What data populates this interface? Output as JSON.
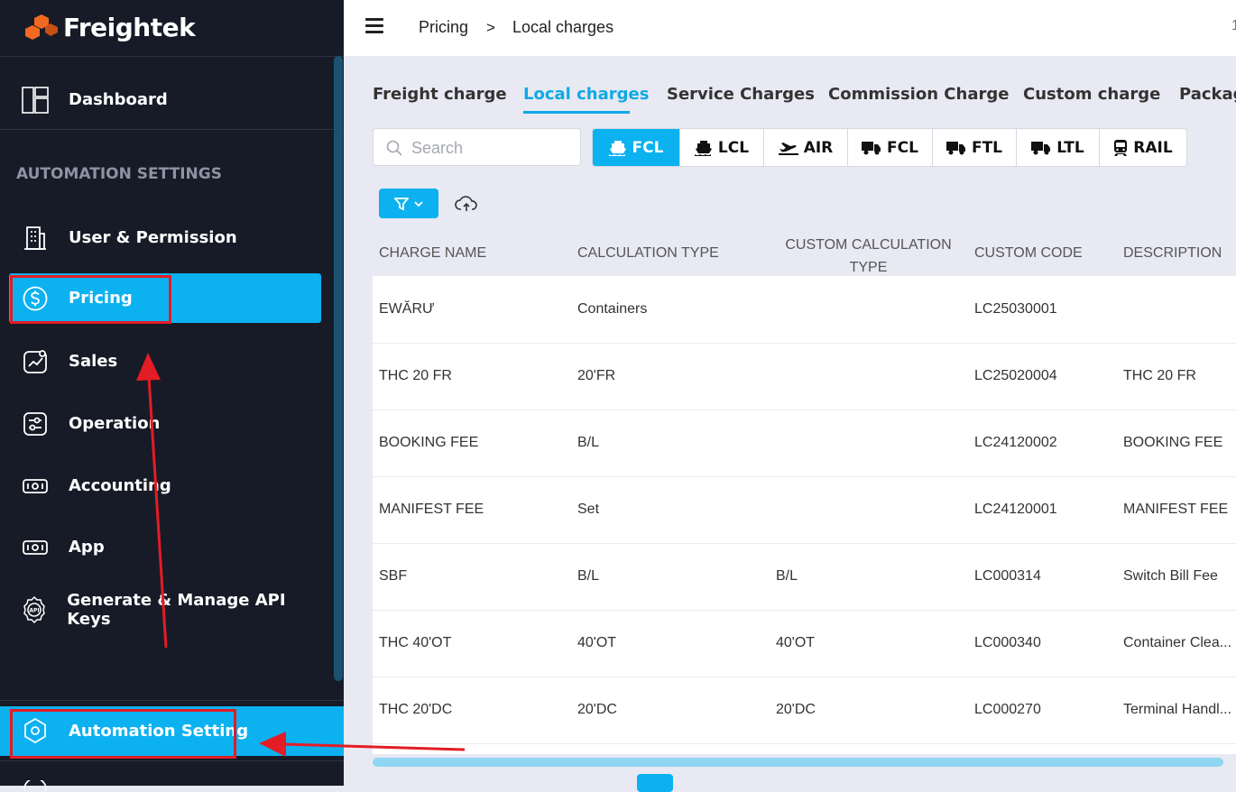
{
  "app": {
    "name": "Freightek"
  },
  "sidebar": {
    "dashboard_label": "Dashboard",
    "section_title": "AUTOMATION SETTINGS",
    "items": [
      {
        "label": "User & Permission",
        "icon": "building-icon"
      },
      {
        "label": "Pricing",
        "icon": "dollar-icon",
        "active": true
      },
      {
        "label": "Sales",
        "icon": "chart-icon"
      },
      {
        "label": "Operation",
        "icon": "sliders-icon"
      },
      {
        "label": "Accounting",
        "icon": "money-icon"
      },
      {
        "label": "App",
        "icon": "money-icon"
      },
      {
        "label": "Generate & Manage API Keys",
        "icon": "api-gear-icon"
      }
    ],
    "bottom_item": {
      "label": "Automation Setting",
      "icon": "hexagon-settings-icon"
    }
  },
  "header": {
    "breadcrumb": [
      "Pricing",
      "Local charges"
    ],
    "separator": ">",
    "right_text": "1"
  },
  "tabs": [
    "Freight charge",
    "Local charges",
    "Service Charges",
    "Commission Charge",
    "Custom charge",
    "Packages"
  ],
  "active_tab": "Local charges",
  "search": {
    "placeholder": "Search"
  },
  "modes": [
    {
      "label": "FCL",
      "icon": "ship-icon",
      "active": true
    },
    {
      "label": "LCL",
      "icon": "ship-icon"
    },
    {
      "label": "AIR",
      "icon": "plane-icon"
    },
    {
      "label": "FCL",
      "icon": "truck-icon"
    },
    {
      "label": "FTL",
      "icon": "truck-icon"
    },
    {
      "label": "LTL",
      "icon": "truck-icon"
    },
    {
      "label": "RAIL",
      "icon": "train-icon"
    }
  ],
  "table": {
    "columns": [
      "CHARGE NAME",
      "CALCULATION TYPE",
      "CUSTOM CALCULATION TYPE",
      "CUSTOM CODE",
      "DESCRIPTION"
    ],
    "rows": [
      [
        "EWĂRƯ",
        "Containers",
        "",
        "LC25030001",
        ""
      ],
      [
        "THC 20 FR",
        "20'FR",
        "",
        "LC25020004",
        "THC 20 FR"
      ],
      [
        "BOOKING FEE",
        "B/L",
        "",
        "LC24120002",
        "BOOKING FEE"
      ],
      [
        "MANIFEST FEE",
        "Set",
        "",
        "LC24120001",
        "MANIFEST FEE"
      ],
      [
        "SBF",
        "B/L",
        "B/L",
        "LC000314",
        "Switch Bill Fee"
      ],
      [
        "THC 40'OT",
        "40'OT",
        "40'OT",
        "LC000340",
        "Container Clea..."
      ],
      [
        "THC 20'DC",
        "20'DC",
        "20'DC",
        "LC000270",
        "Terminal Handl..."
      ]
    ]
  },
  "colors": {
    "sidebar_bg": "#171b27",
    "accent": "#0cb1f0",
    "annotation_red": "#e31c25"
  }
}
